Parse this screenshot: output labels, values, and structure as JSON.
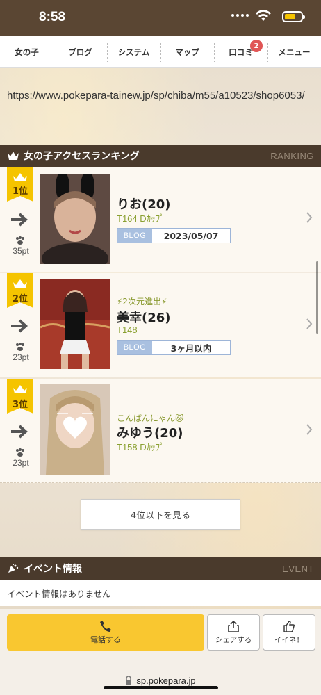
{
  "status": {
    "time": "8:58",
    "battery_color": "#f5c400"
  },
  "nav": {
    "items": [
      {
        "label": "女の子"
      },
      {
        "label": "ブログ"
      },
      {
        "label": "システム"
      },
      {
        "label": "マップ"
      },
      {
        "label": "口コミ",
        "badge": "2"
      },
      {
        "label": "メニュー"
      }
    ]
  },
  "url_text": "https://www.pokepara-tainew.jp/sp/chiba/m55/a10523/shop6053/",
  "ranking": {
    "title": "女の子アクセスランキング",
    "en_label": "RANKING",
    "entries": [
      {
        "rank_label": "1位",
        "points": "35pt",
        "catch": "",
        "name": "りお(20)",
        "spec": "T164 Dｶｯﾌﾟ",
        "blog_tag": "BLOG",
        "blog_date": "2023/05/07"
      },
      {
        "rank_label": "2位",
        "points": "23pt",
        "catch": "⚡2次元進出⚡",
        "name": "美幸(26)",
        "spec": "T148",
        "blog_tag": "BLOG",
        "blog_date": "3ヶ月以内"
      },
      {
        "rank_label": "3位",
        "points": "23pt",
        "catch": "こんばんにゃん🐱",
        "name": "みゆう(20)",
        "spec": "T158 Dｶｯﾌﾟ"
      }
    ],
    "more_label": "4位以下を見る"
  },
  "event": {
    "title": "イベント情報",
    "en_label": "EVENT",
    "empty_text": "イベント情報はありません"
  },
  "actions": {
    "call_label": "電話する",
    "share_label": "シェアする",
    "like_label": "イイネ！"
  },
  "address": "sp.pokepara.jp",
  "colors": {
    "header_brown": "#4a3a2c",
    "crown_gold": "#f5c400",
    "call_yellow": "#f9c730",
    "blog_blue": "#a9c0e0",
    "spec_green": "#8aa030"
  }
}
